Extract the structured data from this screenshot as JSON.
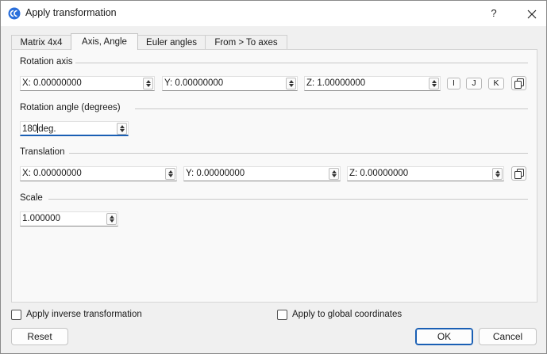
{
  "window": {
    "title": "Apply transformation",
    "help_label": "?"
  },
  "tabs": [
    {
      "label": "Matrix 4x4"
    },
    {
      "label": "Axis, Angle"
    },
    {
      "label": "Euler angles"
    },
    {
      "label": "From > To axes"
    }
  ],
  "active_tab": "Axis, Angle",
  "rotation_axis": {
    "label": "Rotation axis",
    "x": "X: 0.00000000",
    "y": "Y: 0.00000000",
    "z": "Z: 1.00000000",
    "btn_i": "I",
    "btn_j": "J",
    "btn_k": "K"
  },
  "rotation_angle": {
    "label": "Rotation angle (degrees)",
    "value_before_cursor": "180",
    "value_after_cursor": "deg."
  },
  "translation": {
    "label": "Translation",
    "x": "X: 0.00000000",
    "y": "Y: 0.00000000",
    "z": "Z: 0.00000000"
  },
  "scale": {
    "label": "Scale",
    "value": "1.000000"
  },
  "options": {
    "inverse_label": "Apply inverse transformation",
    "inverse_checked": false,
    "global_label": "Apply to global coordinates",
    "global_checked": false
  },
  "buttons": {
    "reset": "Reset",
    "ok": "OK",
    "cancel": "Cancel"
  },
  "colors": {
    "accent": "#1a5fb4",
    "app_icon": "#2a6fdb"
  }
}
